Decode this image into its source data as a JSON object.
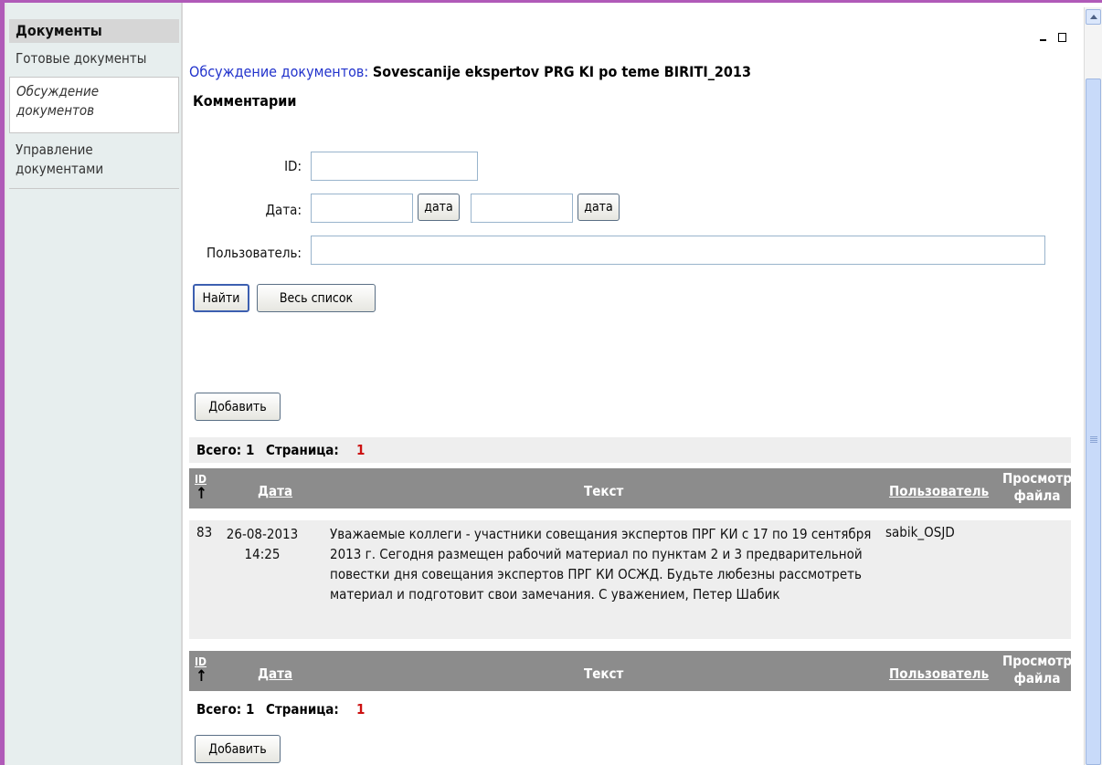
{
  "sidebar": {
    "header": "Документы",
    "items": [
      {
        "label": "Готовые документы"
      },
      {
        "label": "Обсуждение документов"
      },
      {
        "label": "Управление документами"
      }
    ]
  },
  "breadcrumb": {
    "section": "Обсуждение документов",
    "separator": ":",
    "document": "Sovescanije ekspertov PRG KI po teme BIRITI_2013"
  },
  "subtitle": "Комментарии",
  "filter": {
    "id_label": "ID:",
    "id_value": "",
    "date_label": "Дата:",
    "date_from": "",
    "date_to": "",
    "date_button": "дата",
    "user_label": "Пользователь:",
    "user_value": "",
    "find_button": "Найти",
    "all_button": "Весь список"
  },
  "add_button": "Добавить",
  "summary": {
    "total_label": "Всего:",
    "total": "1",
    "page_label": "Страница:",
    "page": "1"
  },
  "table": {
    "columns": {
      "id": "ID",
      "date": "Дата",
      "text": "Текст",
      "user": "Пользователь",
      "file_line1": "Просмотр",
      "file_line2": "файла"
    },
    "sort_arrow": "↑",
    "rows": [
      {
        "id": "83",
        "date": "26-08-2013",
        "time": "14:25",
        "text": "Уважаемые коллеги - участники совещания экспертов ПРГ КИ с 17 по 19 сентября 2013 г. Сегодня размещен рабочий материал по пунктам 2 и 3 предварительной повестки дня совещания экспертов ПРГ КИ ОСЖД. Будьте любезны рассмотреть материал и подготовит свои замечания. С уважением, Петер Шабик",
        "user": "sabik_OSJD"
      }
    ]
  },
  "colors": {
    "frame": "#b05ab8",
    "sidebar_bg": "#e7eeee",
    "table_header": "#8c8c8c",
    "link": "#2233cc",
    "page_number": "#cc1111"
  }
}
